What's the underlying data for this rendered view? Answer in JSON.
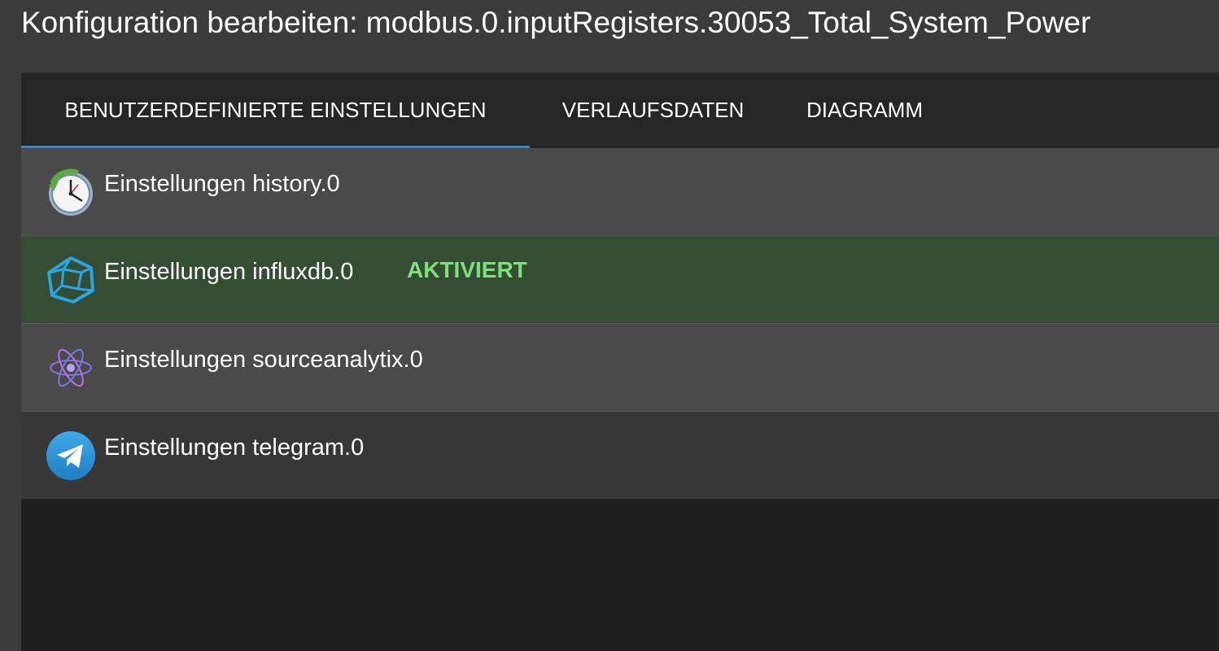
{
  "dialog": {
    "title": "Konfiguration bearbeiten: modbus.0.inputRegisters.30053_Total_System_Power"
  },
  "tabs": [
    {
      "label": "BENUTZERDEFINIERTE EINSTELLUNGEN",
      "selected": true
    },
    {
      "label": "VERLAUFSDATEN",
      "selected": false
    },
    {
      "label": "DIAGRAMM",
      "selected": false
    }
  ],
  "adapters": [
    {
      "label": "Einstellungen history.0",
      "icon": "history-clock-icon",
      "status": ""
    },
    {
      "label": "Einstellungen influxdb.0",
      "icon": "influxdb-icon",
      "status": "AKTIVIERT"
    },
    {
      "label": "Einstellungen sourceanalytix.0",
      "icon": "sourceanalytix-atom-icon",
      "status": ""
    },
    {
      "label": "Einstellungen telegram.0",
      "icon": "telegram-icon",
      "status": ""
    }
  ],
  "colors": {
    "accent": "#3b82c4",
    "active_row": "#344d33",
    "active_status": "#7fe07a"
  }
}
